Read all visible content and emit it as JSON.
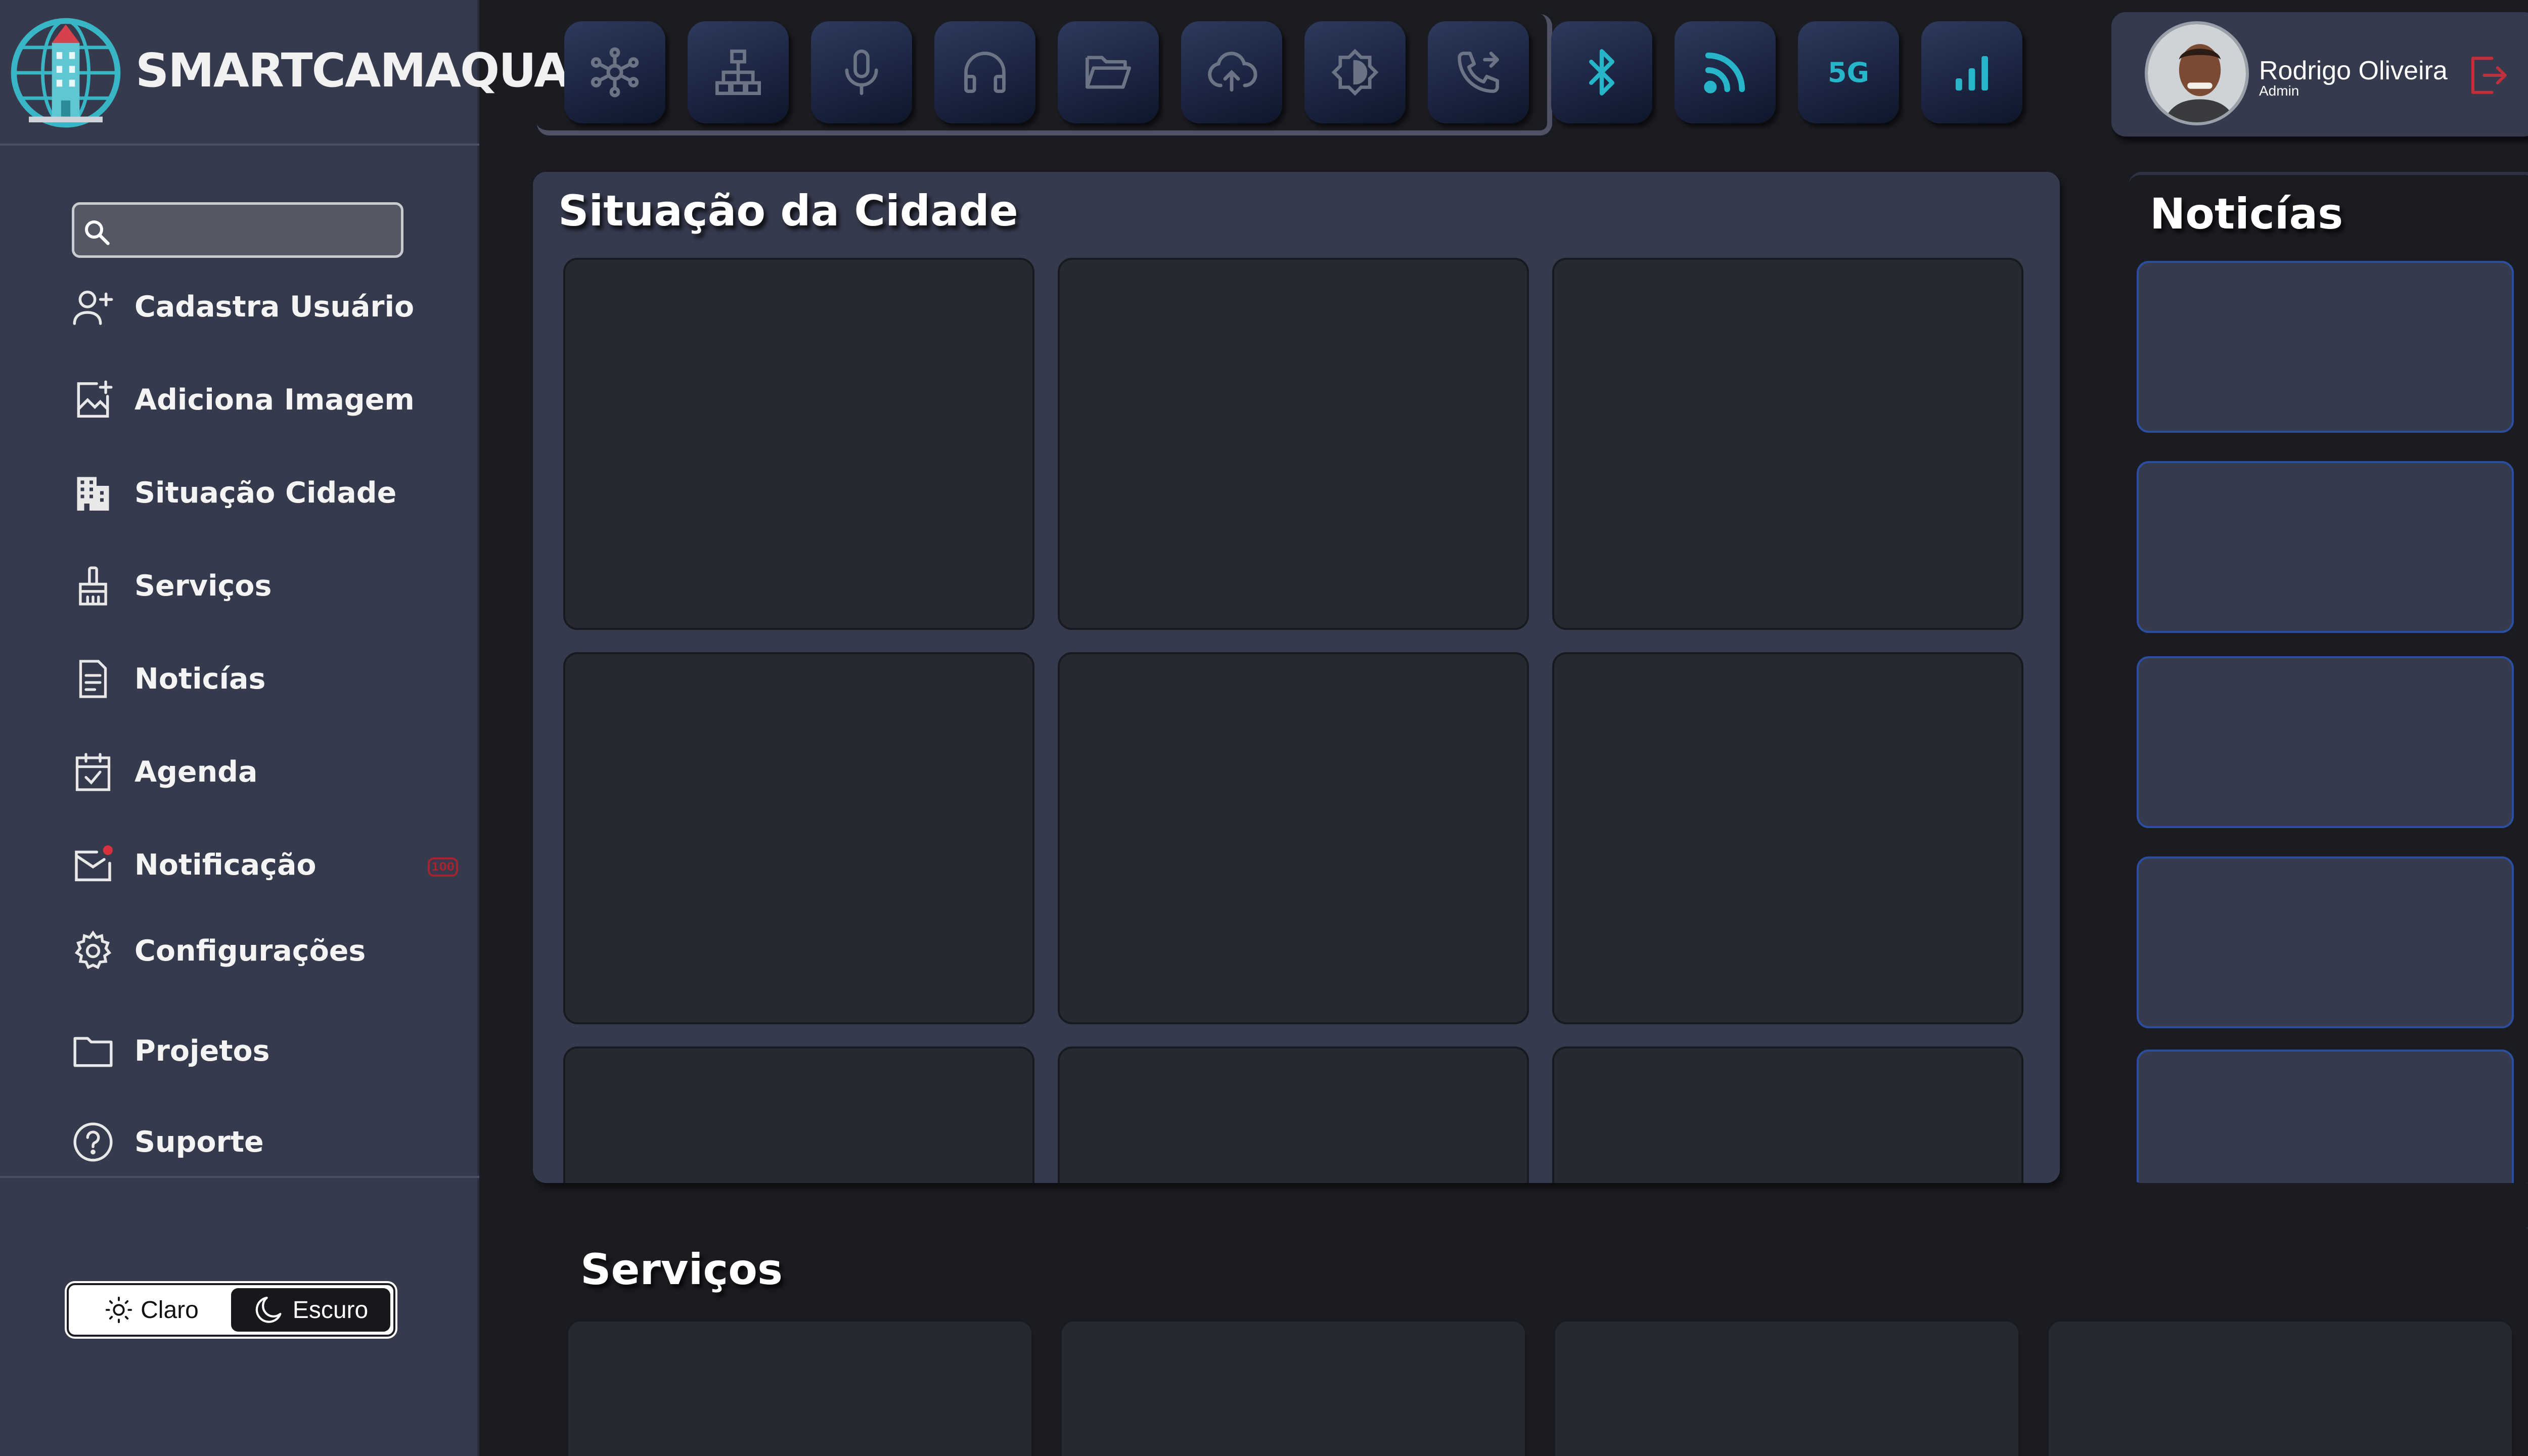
{
  "brand": {
    "name": "SMARTCAMAQUA",
    "logo_icon": "globe-building-icon"
  },
  "search": {
    "placeholder": ""
  },
  "sidebar": {
    "items": [
      {
        "label": "Cadastra Usuário",
        "icon": "user-plus-icon"
      },
      {
        "label": "Adiciona Imagem",
        "icon": "image-add-icon"
      },
      {
        "label": "Situação Cidade",
        "icon": "city-buildings-icon"
      },
      {
        "label": "Serviços",
        "icon": "broom-icon"
      },
      {
        "label": "Noticías",
        "icon": "document-icon"
      },
      {
        "label": "Agenda",
        "icon": "calendar-check-icon"
      },
      {
        "label": "Notificação",
        "icon": "mail-notification-icon",
        "badge": "100"
      },
      {
        "label": "Configurações",
        "icon": "gear-icon"
      },
      {
        "label": "Projetos",
        "icon": "folder-icon"
      },
      {
        "label": "Suporte",
        "icon": "help-circle-icon"
      }
    ]
  },
  "theme": {
    "light_label": "Claro",
    "dark_label": "Escuro",
    "selected": "Escuro"
  },
  "toolbar": {
    "buttons": [
      {
        "icon": "network-hub-icon"
      },
      {
        "icon": "sitemap-icon"
      },
      {
        "icon": "microphone-icon"
      },
      {
        "icon": "headphones-icon"
      },
      {
        "icon": "folder-open-icon"
      },
      {
        "icon": "cloud-upload-icon"
      },
      {
        "icon": "brightness-icon"
      },
      {
        "icon": "phone-forward-icon"
      },
      {
        "icon": "bluetooth-icon"
      },
      {
        "icon": "rss-icon"
      },
      {
        "icon": "5g-icon",
        "text": "5G"
      },
      {
        "icon": "signal-bars-icon"
      }
    ],
    "active_color": "#27b5c9",
    "inactive_color": "#6c7384"
  },
  "user": {
    "name": "Rodrigo Oliveira",
    "role": "Admin"
  },
  "city": {
    "title": "Situação da Cidade"
  },
  "news": {
    "title": "Noticías"
  },
  "services": {
    "title": "Serviços"
  },
  "colors": {
    "background": "#1b1c21",
    "panel": "#363a4d",
    "card": "#272932",
    "accent_cyan": "#27b5c9",
    "alert_red": "#c0303c",
    "news_border": "#2b4ea0"
  }
}
